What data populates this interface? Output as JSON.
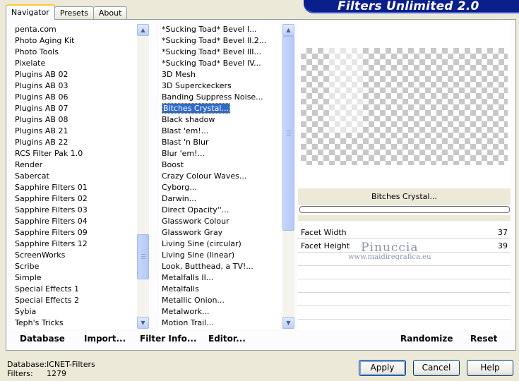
{
  "tabs": [
    {
      "label": "Navigator",
      "active": true
    },
    {
      "label": "Presets",
      "active": false
    },
    {
      "label": "About",
      "active": false
    }
  ],
  "banner": {
    "title": "Filters Unlimited 2.0"
  },
  "categories": {
    "items": [
      "penta.com",
      "Photo Aging Kit",
      "Photo Tools",
      "Pixelate",
      "Plugins AB 02",
      "Plugins AB 03",
      "Plugins AB 06",
      "Plugins AB 07",
      "Plugins AB 08",
      "Plugins AB 21",
      "Plugins AB 22",
      "RCS Filter Pak 1.0",
      "Render",
      "Sabercat",
      "Sapphire Filters 01",
      "Sapphire Filters 02",
      "Sapphire Filters 03",
      "Sapphire Filters 04",
      "Sapphire Filters 09",
      "Sapphire Filters 12",
      "ScreenWorks",
      "Scribe",
      "Simple",
      "Special Effects 1",
      "Special Effects 2",
      "Sybia",
      "Teph's Tricks"
    ]
  },
  "filters": {
    "items": [
      "*Sucking Toad*  Bevel I...",
      "*Sucking Toad*  Bevel II.2...",
      "*Sucking Toad*  Bevel III...",
      "*Sucking Toad*  Bevel IV...",
      "3D Mesh",
      "3D Superckeckers",
      "Banding Suppress Noise...",
      "Bitches Crystal...",
      "Black shadow",
      "Blast 'em!...",
      "Blast 'n Blur",
      "Blur 'em!...",
      "Boost",
      "Crazy Colour Waves...",
      "Cyborg...",
      "Darwin...",
      "Direct Opacity''...",
      "Glasswork Colour",
      "Glasswork Gray",
      "Living Sine (circular)",
      "Living Sine (linear)",
      "Look, Butthead, a TV!...",
      "Metalfalls II...",
      "Metalfalls",
      "Metallic Onion...",
      "Metalwork...",
      "Motion Trail..."
    ],
    "selected": "Bitches Crystal..."
  },
  "toolbar": {
    "database": "Database",
    "import": "Import...",
    "filter_info": "Filter Info...",
    "editor": "Editor..."
  },
  "preview": {
    "filter_name": "Bitches Crystal...",
    "progress": 0
  },
  "params": [
    {
      "label": "Facet Width",
      "value": "37"
    },
    {
      "label": "Facet Height",
      "value": "39"
    }
  ],
  "watermark": {
    "line1": "Pinuccia",
    "line2": "www.maidiregrafica.eu"
  },
  "panel_buttons": {
    "randomize": "Randomize",
    "reset": "Reset"
  },
  "footer": {
    "database_label": "Database:",
    "database_value": "ICNET-Filters",
    "filters_label": "Filters:",
    "filters_value": "1279",
    "apply": "Apply",
    "cancel": "Cancel",
    "help": "Help"
  },
  "icons": {
    "scroll_up": "chevron-up-icon",
    "scroll_down": "chevron-down-icon"
  }
}
